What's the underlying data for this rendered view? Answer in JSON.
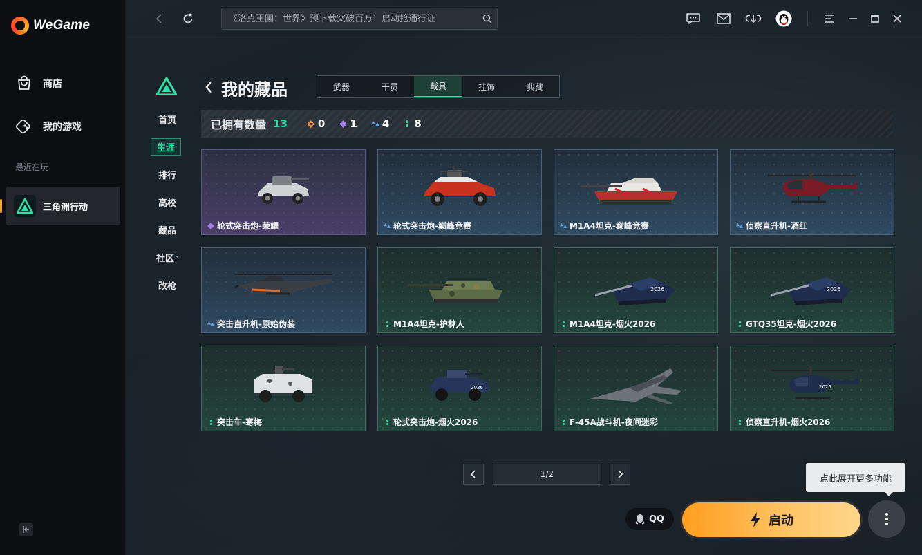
{
  "app": {
    "name": "WeGame"
  },
  "sidebar": {
    "items": [
      {
        "label": "商店"
      },
      {
        "label": "我的游戏"
      }
    ],
    "recent_label": "最近在玩",
    "recent_game": "三角洲行动"
  },
  "topbar": {
    "search_placeholder": "《洛克王国：世界》预下载突破百万！启动抢通行证"
  },
  "inner_nav": {
    "items": [
      {
        "label": "首页"
      },
      {
        "label": "生涯"
      },
      {
        "label": "排行"
      },
      {
        "label": "高校"
      },
      {
        "label": "藏品"
      },
      {
        "label": "社区"
      },
      {
        "label": "改枪"
      }
    ],
    "community_suffix": "˄"
  },
  "page": {
    "title": "我的藏品",
    "tabs": [
      {
        "label": "武器"
      },
      {
        "label": "干员"
      },
      {
        "label": "载具"
      },
      {
        "label": "挂饰"
      },
      {
        "label": "典藏"
      }
    ],
    "active_tab": "载具"
  },
  "owned": {
    "label": "已拥有数量",
    "total": "13",
    "counts": [
      {
        "rarity": "orange",
        "color": "#e8883a",
        "value": "0"
      },
      {
        "rarity": "purple",
        "color": "#a77ee8",
        "value": "1"
      },
      {
        "rarity": "blue",
        "color": "#5ea6e6",
        "value": "4"
      },
      {
        "rarity": "green",
        "color": "#33d39a",
        "value": "8"
      }
    ]
  },
  "cards": [
    {
      "name": "轮式突击炮-荣耀",
      "rarity": "purple",
      "icon": "vehicle-wheeled-icon"
    },
    {
      "name": "轮式突击炮-巅峰竞赛",
      "rarity": "blue",
      "icon": "vehicle-wheeled-red-icon"
    },
    {
      "name": "M1A4坦克-巅峰竞赛",
      "rarity": "blue",
      "icon": "tank-icon"
    },
    {
      "name": "侦察直升机-酒红",
      "rarity": "blue",
      "icon": "helicopter-icon"
    },
    {
      "name": "突击直升机-原始伪装",
      "rarity": "blue",
      "icon": "attack-helicopter-icon"
    },
    {
      "name": "M1A4坦克-护林人",
      "rarity": "green",
      "icon": "tank-camo-icon"
    },
    {
      "name": "M1A4坦克-烟火2026",
      "rarity": "green",
      "icon": "tank-dark-icon"
    },
    {
      "name": "GTQ35坦克-烟火2026",
      "rarity": "green",
      "icon": "tank-dark-icon"
    },
    {
      "name": "突击车-寒梅",
      "rarity": "green",
      "icon": "assault-vehicle-icon"
    },
    {
      "name": "轮式突击炮-烟火2026",
      "rarity": "green",
      "icon": "vehicle-wheeled-dark-icon"
    },
    {
      "name": "F-45A战斗机-夜间迷彩",
      "rarity": "green",
      "icon": "fighter-jet-icon"
    },
    {
      "name": "侦察直升机-烟火2026",
      "rarity": "green",
      "icon": "helicopter-dark-icon"
    }
  ],
  "pagination": {
    "label": "1/2"
  },
  "bottom": {
    "tooltip": "点此展开更多功能",
    "qq_label": "QQ",
    "launch_label": "启动"
  },
  "colors": {
    "accent_green": "#2be3a5",
    "launch_orange": "#ff9e1f"
  }
}
